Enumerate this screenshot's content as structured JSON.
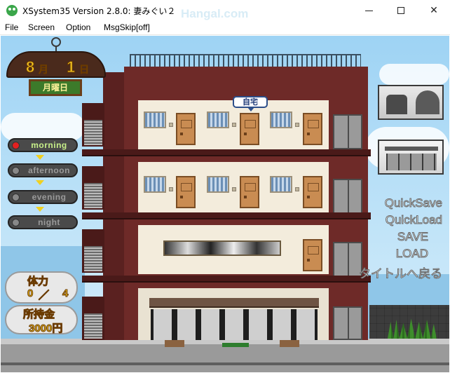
{
  "window": {
    "title": "XSystem35 Version 2.8.0: 妻みぐい２",
    "watermark": "Hangal.com"
  },
  "menubar": {
    "items": [
      "File",
      "Screen",
      "Option",
      "MsgSkip[off]"
    ]
  },
  "date": {
    "month": "8",
    "month_unit": "月",
    "day": "1",
    "day_unit": "日",
    "weekday": "月曜日"
  },
  "time_of_day": [
    {
      "label": "morning",
      "active": true
    },
    {
      "label": "afternoon",
      "active": false
    },
    {
      "label": "evening",
      "active": false
    },
    {
      "label": "night",
      "active": false
    }
  ],
  "stamina": {
    "title": "体力",
    "current": "0",
    "separator": "／",
    "max": "4"
  },
  "money": {
    "title": "所持金",
    "value": "3000円"
  },
  "location_tag": "自宅",
  "system_menu": [
    "QuickSave",
    "QuickLoad",
    "SAVE",
    "LOAD",
    "タイトルへ戻る"
  ],
  "colors": {
    "active_dot": "#e22020",
    "active_text": "#c8f08a",
    "gold_text": "#f5c623"
  },
  "icons": {
    "app": "app-icon",
    "minimize": "minimize-icon",
    "maximize": "maximize-icon",
    "close": "close-icon"
  }
}
